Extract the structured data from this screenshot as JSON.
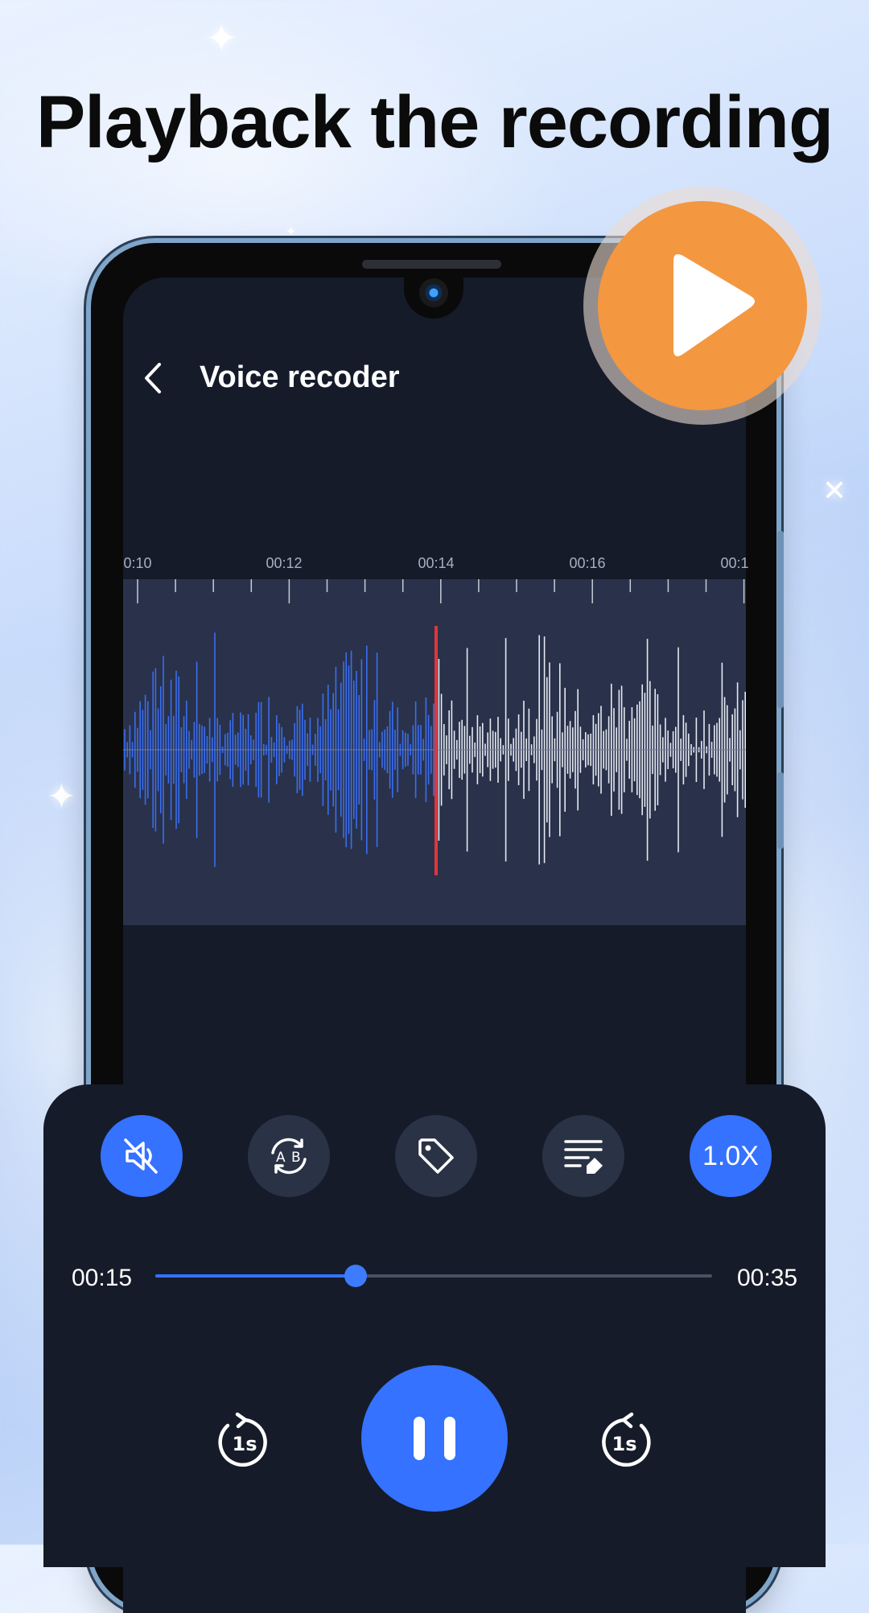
{
  "headline": "Playback the recording",
  "app": {
    "title": "Voice recoder",
    "back_icon": "chevron-left-icon"
  },
  "timeline": {
    "labels": [
      "0:10",
      "00:12",
      "00:14",
      "00:16",
      "00:1"
    ]
  },
  "waveform": {
    "played_color": "#3a6df0",
    "unplayed_color": "#e6e9f2",
    "playhead_color": "#e0363a"
  },
  "overlay": {
    "play_icon": "play-icon",
    "accent_color": "#f39741"
  },
  "toolbar": {
    "mute_icon": "mute-icon",
    "ab_repeat_icon": "ab-repeat-icon",
    "tag_icon": "tag-icon",
    "notes_icon": "edit-notes-icon",
    "speed_label": "1.0X"
  },
  "player": {
    "current_time": "00:15",
    "total_time": "00:35",
    "progress": 0.36,
    "rewind_label": "1s",
    "forward_label": "1s",
    "pause_icon": "pause-icon",
    "accent_color": "#3472ff"
  }
}
